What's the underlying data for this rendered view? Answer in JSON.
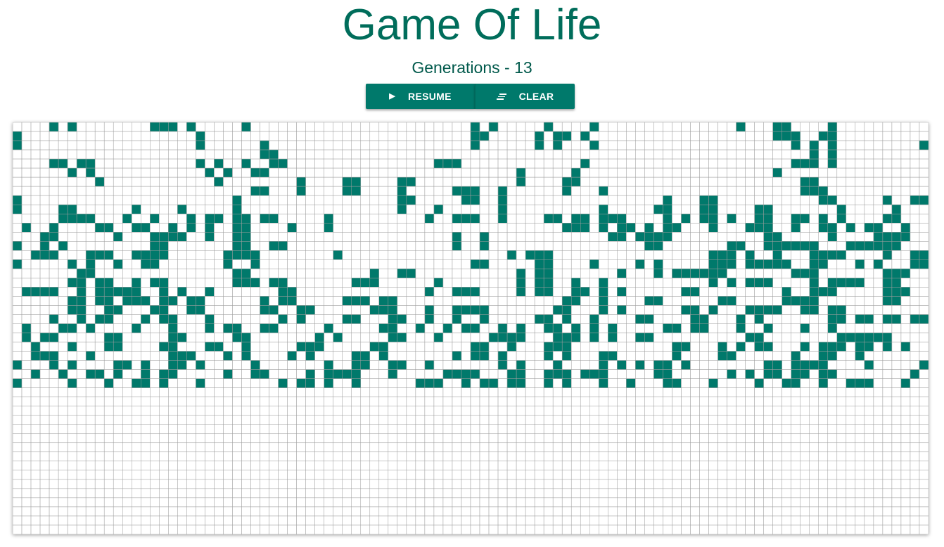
{
  "header": {
    "title": "Game Of Life"
  },
  "status": {
    "generations_text": "Generations - 13",
    "generation": 13
  },
  "controls": {
    "resume_label": "RESUME",
    "resume_icon": "play-icon",
    "clear_label": "CLEAR",
    "clear_icon": "clear-all-icon"
  },
  "colors": {
    "primary": "#00796b",
    "title": "#006d5b",
    "cell": "#00796b",
    "grid": "#9e9e9e",
    "background": "#ffffff"
  },
  "board": {
    "cols": 100,
    "rows": 45,
    "live_cells": [
      "0,4",
      "0,6",
      "0,15",
      "0,16",
      "0,17",
      "0,19",
      "0,25",
      "0,50",
      "0,52",
      "0,58",
      "0,63",
      "0,79",
      "0,83",
      "0,84",
      "0,89",
      "1,0",
      "1,20",
      "1,50",
      "1,51",
      "1,57",
      "1,59",
      "1,60",
      "1,62",
      "1,83",
      "1,84",
      "1,85",
      "1,88",
      "1,89",
      "2,0",
      "2,20",
      "2,27",
      "2,50",
      "2,57",
      "2,59",
      "2,63",
      "2,85",
      "2,87",
      "2,89",
      "2,99",
      "3,27",
      "3,28",
      "3,87",
      "3,89",
      "4,4",
      "4,5",
      "4,7",
      "4,8",
      "4,20",
      "4,22",
      "4,25",
      "4,28",
      "4,29",
      "4,46",
      "4,47",
      "4,48",
      "4,62",
      "4,85",
      "4,86",
      "4,87",
      "4,89",
      "5,6",
      "5,8",
      "5,21",
      "5,23",
      "5,26",
      "5,27",
      "5,55",
      "5,61",
      "5,83",
      "6,9",
      "6,22",
      "6,31",
      "6,36",
      "6,37",
      "6,42",
      "6,43",
      "6,55",
      "6,60",
      "6,61",
      "6,86",
      "6,87",
      "7,26",
      "7,27",
      "7,31",
      "7,36",
      "7,37",
      "7,42",
      "7,48",
      "7,49",
      "7,50",
      "7,53",
      "7,60",
      "7,64",
      "7,86",
      "7,87",
      "7,88",
      "8,0",
      "8,24",
      "8,42",
      "8,43",
      "8,49",
      "8,50",
      "8,53",
      "8,71",
      "8,75",
      "8,76",
      "8,88",
      "8,89",
      "8,95",
      "8,98",
      "8,99",
      "9,0",
      "9,5",
      "9,6",
      "9,13",
      "9,18",
      "9,24",
      "9,42",
      "9,46",
      "9,53",
      "9,64",
      "9,70",
      "9,71",
      "9,75",
      "9,76",
      "9,81",
      "9,82",
      "9,90",
      "9,96",
      "10,5",
      "10,6",
      "10,7",
      "10,8",
      "10,12",
      "10,15",
      "10,19",
      "10,21",
      "10,22",
      "10,24",
      "10,25",
      "10,27",
      "10,28",
      "10,34",
      "10,45",
      "10,48",
      "10,49",
      "10,50",
      "10,53",
      "10,58",
      "10,59",
      "10,61",
      "10,62",
      "10,64",
      "10,65",
      "10,66",
      "10,71",
      "10,73",
      "10,75",
      "10,76",
      "10,78",
      "10,81",
      "10,82",
      "10,85",
      "10,86",
      "10,88",
      "10,90",
      "10,95",
      "10,96",
      "11,1",
      "11,4",
      "11,9",
      "11,10",
      "11,13",
      "11,14",
      "11,17",
      "11,19",
      "11,21",
      "11,24",
      "11,25",
      "11,30",
      "11,34",
      "11,60",
      "11,61",
      "11,62",
      "11,64",
      "11,66",
      "11,67",
      "11,69",
      "11,71",
      "11,72",
      "11,76",
      "11,80",
      "11,81",
      "11,82",
      "11,85",
      "11,88",
      "11,89",
      "11,91",
      "11,93",
      "11,94",
      "11,97",
      "12,3",
      "12,4",
      "12,11",
      "12,15",
      "12,16",
      "12,17",
      "12,18",
      "12,21",
      "12,24",
      "12,25",
      "12,48",
      "12,51",
      "12,65",
      "12,66",
      "12,68",
      "12,69",
      "12,70",
      "12,71",
      "12,82",
      "12,83",
      "12,89",
      "12,94",
      "12,95",
      "12,96",
      "12,97",
      "13,0",
      "13,3",
      "13,5",
      "13,15",
      "13,16",
      "13,24",
      "13,25",
      "13,28",
      "13,29",
      "13,48",
      "13,51",
      "13,69",
      "13,70",
      "13,78",
      "13,79",
      "13,82",
      "13,83",
      "13,84",
      "13,85",
      "13,86",
      "13,87",
      "13,91",
      "13,92",
      "13,93",
      "13,94",
      "13,95",
      "13,96",
      "14,2",
      "14,3",
      "14,4",
      "14,8",
      "14,9",
      "14,10",
      "14,13",
      "14,14",
      "14,15",
      "14,16",
      "14,23",
      "14,24",
      "14,25",
      "14,26",
      "14,35",
      "14,54",
      "14,56",
      "14,57",
      "14,58",
      "14,76",
      "14,77",
      "14,78",
      "14,80",
      "14,83",
      "14,87",
      "14,88",
      "14,89",
      "14,90",
      "14,95",
      "14,98",
      "14,99",
      "15,0",
      "15,6",
      "15,8",
      "15,11",
      "15,14",
      "15,15",
      "15,23",
      "15,26",
      "15,50",
      "15,51",
      "15,57",
      "15,58",
      "15,63",
      "15,68",
      "15,70",
      "15,76",
      "15,77",
      "15,78",
      "15,80",
      "15,81",
      "15,82",
      "15,83",
      "15,84",
      "15,87",
      "15,88",
      "15,92",
      "15,94",
      "15,98",
      "15,99",
      "16,7",
      "16,8",
      "16,24",
      "16,25",
      "16,39",
      "16,42",
      "16,43",
      "16,55",
      "16,57",
      "16,58",
      "16,66",
      "16,70",
      "16,72",
      "16,73",
      "16,74",
      "16,75",
      "16,76",
      "16,77",
      "16,85",
      "16,86",
      "16,87",
      "16,95",
      "16,96",
      "16,97",
      "17,6",
      "17,7",
      "17,9",
      "17,10",
      "17,13",
      "17,15",
      "17,16",
      "17,24",
      "17,25",
      "17,26",
      "17,28",
      "17,29",
      "17,37",
      "17,38",
      "17,39",
      "17,46",
      "17,55",
      "17,57",
      "17,58",
      "17,61",
      "17,64",
      "17,76",
      "17,78",
      "17,80",
      "17,81",
      "17,82",
      "17,87",
      "17,89",
      "17,90",
      "17,91",
      "17,92",
      "17,95",
      "17,96",
      "18,1",
      "18,2",
      "18,3",
      "18,4",
      "18,7",
      "18,9",
      "18,10",
      "18,11",
      "18,12",
      "18,13",
      "18,16",
      "18,18",
      "18,21",
      "18,29",
      "18,30",
      "18,45",
      "18,48",
      "18,49",
      "18,50",
      "18,55",
      "18,57",
      "18,58",
      "18,61",
      "18,62",
      "18,64",
      "18,66",
      "18,73",
      "18,74",
      "18,84",
      "18,87",
      "18,88",
      "18,89",
      "18,95",
      "18,96",
      "18,97",
      "19,6",
      "19,7",
      "19,9",
      "19,10",
      "19,12",
      "19,13",
      "19,14",
      "19,16",
      "19,17",
      "19,19",
      "19,20",
      "19,27",
      "19,29",
      "19,30",
      "19,36",
      "19,37",
      "19,38",
      "19,40",
      "19,41",
      "19,60",
      "19,61",
      "19,64",
      "19,69",
      "19,70",
      "19,77",
      "19,78",
      "19,84",
      "19,85",
      "19,86",
      "19,87",
      "19,95",
      "19,96",
      "20,6",
      "20,7",
      "20,10",
      "20,11",
      "20,15",
      "20,16",
      "20,19",
      "20,20",
      "20,27",
      "20,28",
      "20,31",
      "20,32",
      "20,39",
      "20,40",
      "20,41",
      "20,45",
      "20,48",
      "20,49",
      "20,50",
      "20,51",
      "20,59",
      "20,60",
      "20,64",
      "20,66",
      "20,73",
      "20,74",
      "20,76",
      "20,80",
      "20,81",
      "20,82",
      "20,83",
      "20,86",
      "20,87",
      "20,89",
      "20,90",
      "21,4",
      "21,7",
      "21,9",
      "21,10",
      "21,14",
      "21,16",
      "21,17",
      "21,21",
      "21,29",
      "21,31",
      "21,36",
      "21,37",
      "21,41",
      "21,42",
      "21,45",
      "21,48",
      "21,51",
      "21,57",
      "21,58",
      "21,60",
      "21,63",
      "21,68",
      "21,69",
      "21,74",
      "21,75",
      "21,79",
      "21,81",
      "21,89",
      "21,90",
      "21,92",
      "21,93",
      "21,95",
      "21,96",
      "21,98",
      "21,99",
      "22,1",
      "22,5",
      "22,6",
      "22,8",
      "22,13",
      "22,17",
      "22,21",
      "22,23",
      "22,24",
      "22,27",
      "22,28",
      "22,34",
      "22,40",
      "22,41",
      "22,44",
      "22,47",
      "22,49",
      "22,50",
      "22,53",
      "22,55",
      "22,58",
      "22,59",
      "22,61",
      "22,63",
      "22,65",
      "22,71",
      "22,72",
      "22,74",
      "22,75",
      "22,79",
      "22,82",
      "22,86",
      "22,89",
      "23,1",
      "23,3",
      "23,4",
      "23,10",
      "23,11",
      "23,17",
      "23,18",
      "23,24",
      "23,25",
      "23,33",
      "23,35",
      "23,41",
      "23,42",
      "23,46",
      "23,52",
      "23,53",
      "23,54",
      "23,55",
      "23,59",
      "23,60",
      "23,61",
      "23,63",
      "23,65",
      "23,68",
      "23,69",
      "23,80",
      "23,81",
      "23,90",
      "23,91",
      "23,92",
      "23,93",
      "23,94",
      "23,95",
      "24,2",
      "24,6",
      "24,10",
      "24,11",
      "24,16",
      "24,17",
      "24,21",
      "24,22",
      "24,25",
      "24,31",
      "24,32",
      "24,33",
      "24,39",
      "24,40",
      "24,50",
      "24,51",
      "24,54",
      "24,58",
      "24,59",
      "24,60",
      "24,72",
      "24,73",
      "24,77",
      "24,79",
      "24,81",
      "24,82",
      "24,86",
      "24,88",
      "24,89",
      "24,90",
      "24,92",
      "24,93",
      "24,95",
      "24,97",
      "25,2",
      "25,3",
      "25,4",
      "25,8",
      "25,17",
      "25,18",
      "25,19",
      "25,23",
      "25,25",
      "25,30",
      "25,32",
      "25,37",
      "25,38",
      "25,40",
      "25,48",
      "25,50",
      "25,51",
      "25,53",
      "25,58",
      "25,60",
      "25,64",
      "25,65",
      "25,72",
      "25,77",
      "25,78",
      "25,85",
      "25,88",
      "25,89",
      "25,92",
      "26,0",
      "26,4",
      "26,6",
      "26,11",
      "26,12",
      "26,14",
      "26,17",
      "26,18",
      "26,20",
      "26,26",
      "26,34",
      "26,37",
      "26,38",
      "26,41",
      "26,42",
      "26,45",
      "26,53",
      "26,55",
      "26,59",
      "26,64",
      "26,66",
      "26,68",
      "26,70",
      "26,71",
      "26,73",
      "26,82",
      "26,83",
      "26,85",
      "26,86",
      "26,87",
      "26,88",
      "26,93",
      "26,99",
      "27,2",
      "27,5",
      "27,8",
      "27,9",
      "27,11",
      "27,14",
      "27,16",
      "27,17",
      "27,23",
      "27,26",
      "27,27",
      "27,32",
      "27,34",
      "27,35",
      "27,36",
      "27,37",
      "27,41",
      "27,47",
      "27,48",
      "27,49",
      "27,50",
      "27,54",
      "27,55",
      "27,58",
      "27,59",
      "27,60",
      "27,62",
      "27,63",
      "27,64",
      "27,70",
      "27,71",
      "27,78",
      "27,80",
      "27,82",
      "27,83",
      "27,85",
      "27,86",
      "27,88",
      "27,89",
      "27,98",
      "28,0",
      "28,6",
      "28,10",
      "28,13",
      "28,14",
      "28,16",
      "28,20",
      "28,29",
      "28,31",
      "28,32",
      "28,34",
      "28,37",
      "28,44",
      "28,45",
      "28,46",
      "28,49",
      "28,51",
      "28,52",
      "28,54",
      "28,55",
      "28,58",
      "28,60",
      "28,64",
      "28,67",
      "28,71",
      "28,72",
      "28,76",
      "28,81",
      "28,84",
      "28,85",
      "28,88",
      "28,91",
      "28,92",
      "28,93",
      "28,97"
    ]
  }
}
